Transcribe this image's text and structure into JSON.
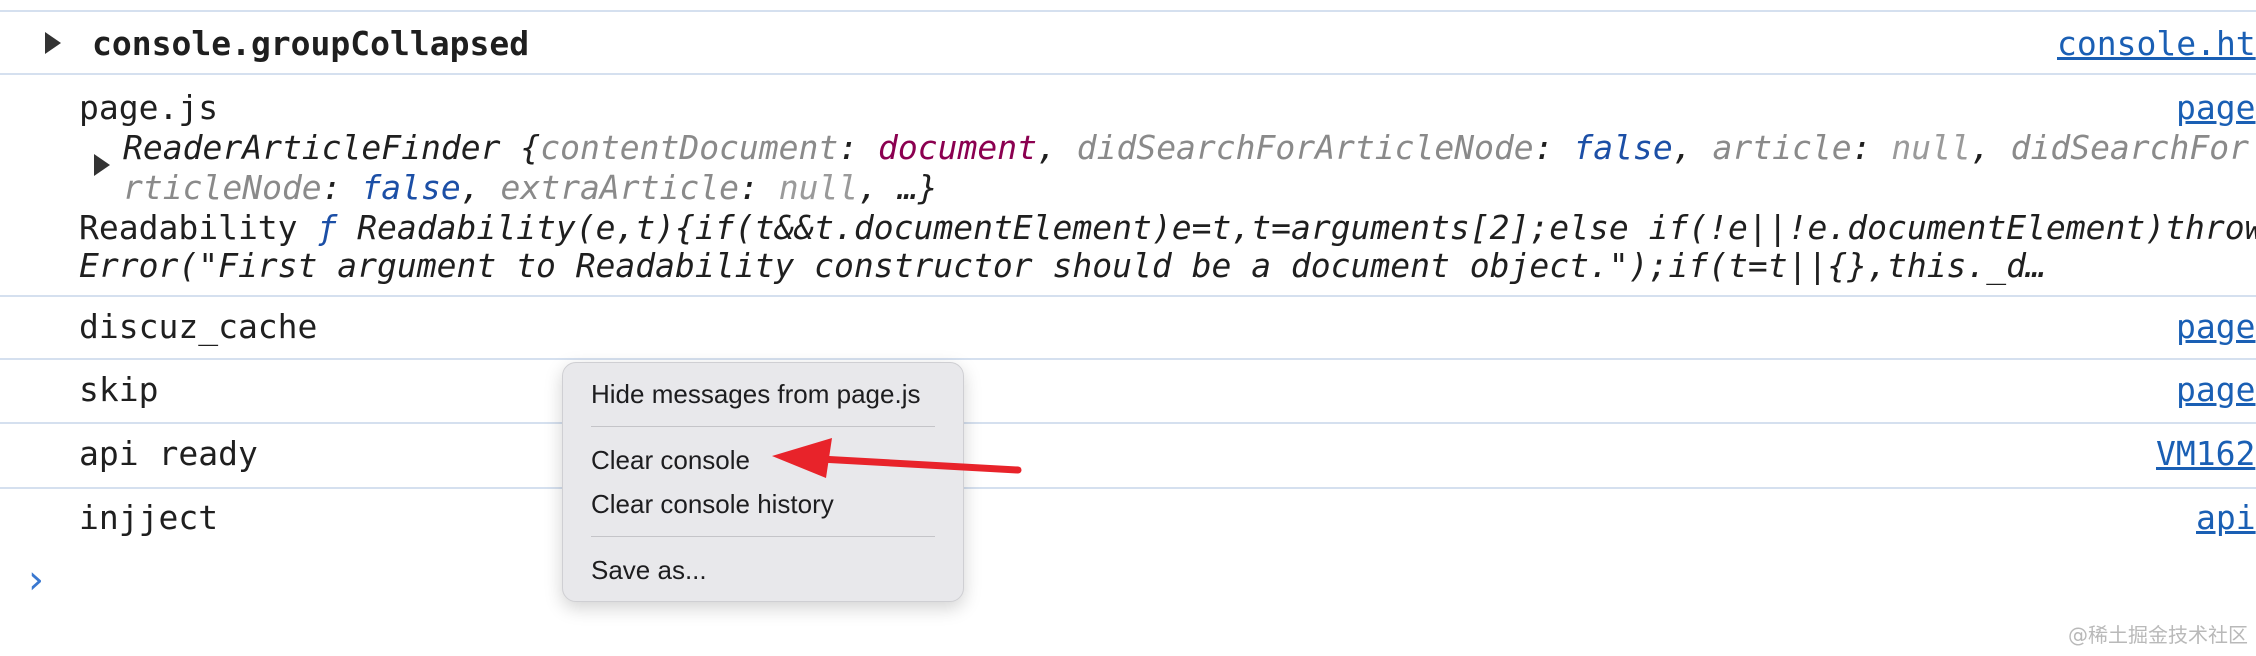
{
  "group": {
    "title": "console.groupCollapsed",
    "source": "console.ht"
  },
  "entry1": {
    "source_label": "page.js",
    "source_link": "page",
    "obj_name": "ReaderArticleFinder",
    "open_brace": "{",
    "k_contentDocument": "contentDocument",
    "v_contentDocument": "document",
    "k_didSearch": "didSearchForArticleNode",
    "v_didSearch": "false",
    "k_article": "article",
    "v_article": "null",
    "k_didSearchFor": "didSearchFor",
    "k_rticleNode": "rticleNode",
    "v_rticleNode": "false",
    "k_extra": "extraArticle",
    "v_extra": "null",
    "tail": "…}",
    "readability_label": "Readability",
    "readability_f": "ƒ",
    "readability_code1": "Readability(e,t){if(t&&t.documentElement)e=t,t=arguments[2];else if(!e||!e.documentElement)throw",
    "readability_code2": "Error(\"First argument to Readability constructor should be a document object.\");if(t=t||{},this._d…"
  },
  "rows": [
    {
      "text": "discuz_cache",
      "source": "page"
    },
    {
      "text": "skip",
      "source": "page"
    },
    {
      "text": "api ready",
      "source": "VM162"
    },
    {
      "text": "injject",
      "source": "api"
    }
  ],
  "prompt_symbol": "›",
  "context_menu": {
    "hide": "Hide messages from page.js",
    "clear": "Clear console",
    "clear_history": "Clear console history",
    "save": "Save as..."
  },
  "annotation_color": "#e8232a",
  "watermark": "@稀土掘金技术社区"
}
